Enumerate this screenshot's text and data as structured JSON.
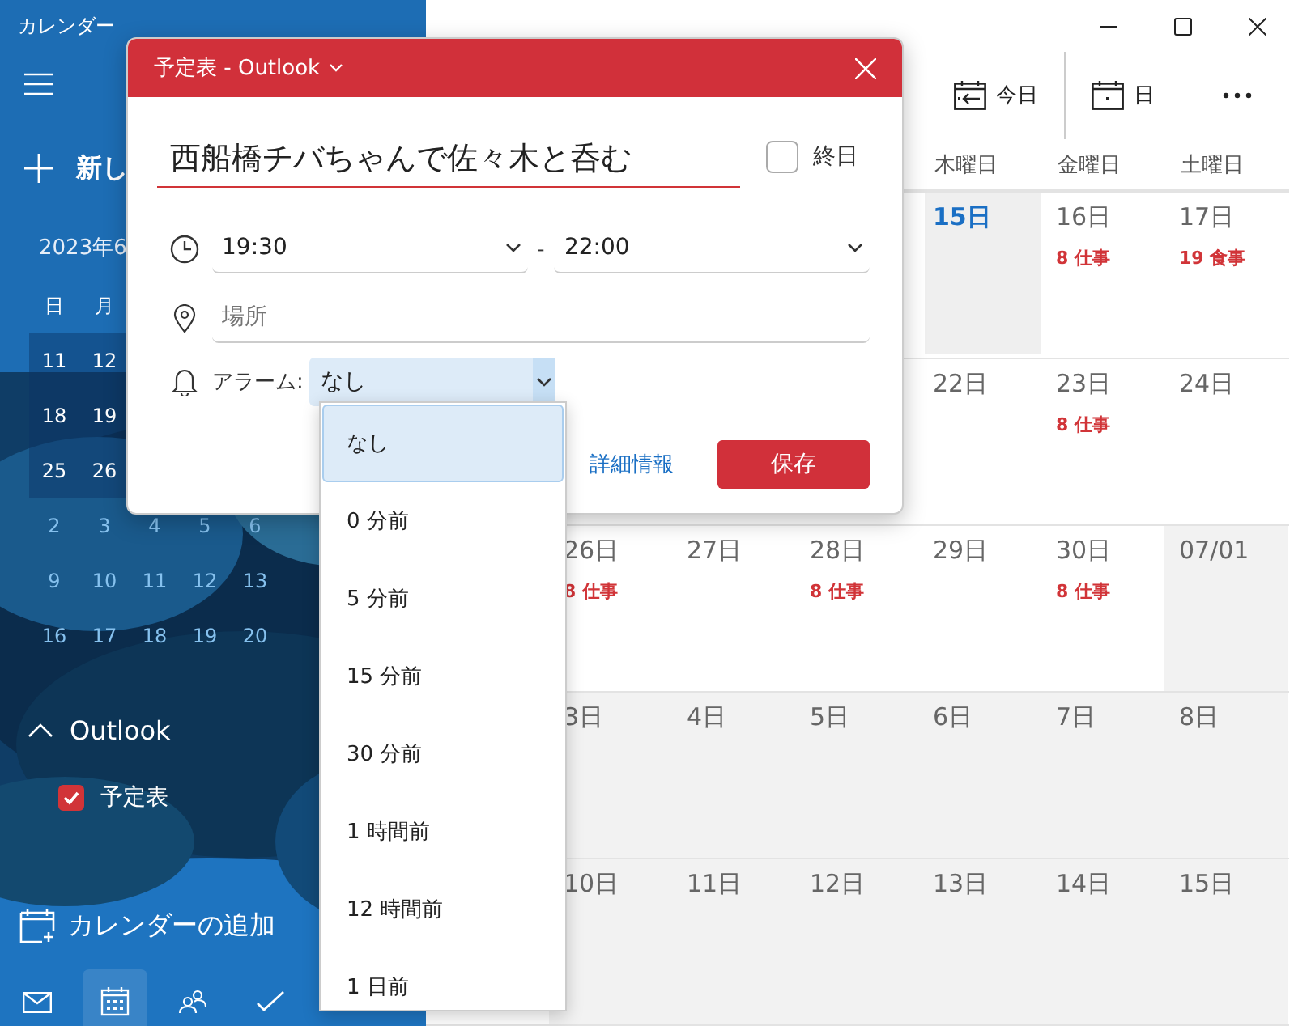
{
  "window": {
    "title": "カレンダー"
  },
  "sidebar": {
    "new_event": "新し",
    "mini_calendar": {
      "month": "2023年6",
      "weekdays": [
        "日",
        "月"
      ],
      "weeks": [
        {
          "days": [
            "11",
            "12"
          ],
          "selected": true,
          "current_month": true
        },
        {
          "days": [
            "18",
            "19"
          ],
          "selected": true,
          "current_month": true
        },
        {
          "days": [
            "25",
            "26"
          ],
          "selected": true,
          "current_month": true
        },
        {
          "days": [
            "2",
            "3",
            "4",
            "5",
            "6"
          ],
          "selected": false,
          "current_month": false
        },
        {
          "days": [
            "9",
            "10",
            "11",
            "12",
            "13"
          ],
          "selected": false,
          "current_month": false
        },
        {
          "days": [
            "16",
            "17",
            "18",
            "19",
            "20"
          ],
          "selected": false,
          "current_month": false
        }
      ]
    },
    "account": {
      "label": "Outlook",
      "expanded": true,
      "calendars": [
        {
          "label": "予定表",
          "checked": true,
          "color": "#d13438"
        }
      ]
    },
    "add_calendar": "カレンダーの追加",
    "nav": [
      {
        "kind": "mail",
        "selected": false
      },
      {
        "kind": "calendar",
        "selected": true
      },
      {
        "kind": "people",
        "selected": false
      },
      {
        "kind": "tasks",
        "selected": false
      }
    ]
  },
  "toolbar": [
    {
      "kind": "today",
      "label": "今日"
    },
    {
      "kind": "day",
      "label": "日"
    },
    {
      "kind": "more"
    }
  ],
  "calendar": {
    "weekdays": [
      "木曜日",
      "金曜日",
      "土曜日"
    ],
    "weeks": [
      {
        "cells": [
          {
            "day": "15日",
            "today": true,
            "other_month": false
          },
          {
            "day": "16日",
            "today": false,
            "other_month": false,
            "events": [
              "8 仕事"
            ]
          },
          {
            "day": "17日",
            "today": false,
            "other_month": false,
            "events": [
              "19 食事"
            ]
          }
        ]
      },
      {
        "cells": [
          {
            "day": "22日",
            "today": false,
            "other_month": false
          },
          {
            "day": "23日",
            "today": false,
            "other_month": false,
            "events": [
              "8 仕事"
            ]
          },
          {
            "day": "24日",
            "today": false,
            "other_month": false
          }
        ]
      },
      {
        "cells": [
          {
            "day": "26日",
            "today": false,
            "other_month": false,
            "events": [
              "8 仕事"
            ]
          },
          {
            "day": "27日",
            "today": false,
            "other_month": false
          },
          {
            "day": "28日",
            "today": false,
            "other_month": false,
            "events": [
              "8 仕事"
            ]
          },
          {
            "day": "29日",
            "today": false,
            "other_month": false
          },
          {
            "day": "30日",
            "today": false,
            "other_month": false,
            "events": [
              "8 仕事"
            ]
          },
          {
            "day": "07/01",
            "today": false,
            "other_month": true
          }
        ]
      },
      {
        "cells": [
          {
            "day": "3日",
            "today": false,
            "other_month": true
          },
          {
            "day": "4日",
            "today": false,
            "other_month": true
          },
          {
            "day": "5日",
            "today": false,
            "other_month": true
          },
          {
            "day": "6日",
            "today": false,
            "other_month": true
          },
          {
            "day": "7日",
            "today": false,
            "other_month": true
          },
          {
            "day": "8日",
            "today": false,
            "other_month": true
          }
        ]
      },
      {
        "cells": [
          {
            "day": "10日",
            "today": false,
            "other_month": true
          },
          {
            "day": "11日",
            "today": false,
            "other_month": true
          },
          {
            "day": "12日",
            "today": false,
            "other_month": true
          },
          {
            "day": "13日",
            "today": false,
            "other_month": true
          },
          {
            "day": "14日",
            "today": false,
            "other_month": true
          },
          {
            "day": "15日",
            "today": false,
            "other_month": true
          }
        ]
      }
    ]
  },
  "event_popup": {
    "calendar_label": "予定表 - Outlook",
    "title": "西船橋チバちゃんで佐々木と呑む",
    "all_day": {
      "label": "終日",
      "checked": false
    },
    "start": "19:30",
    "separator": "-",
    "end": "22:00",
    "location": {
      "placeholder": "場所"
    },
    "alarm": {
      "label": "アラーム:",
      "value": "なし",
      "expanded": true,
      "options": [
        {
          "label": "なし",
          "selected": true
        },
        {
          "label": "0 分前",
          "selected": false
        },
        {
          "label": "5 分前",
          "selected": false
        },
        {
          "label": "15 分前",
          "selected": false
        },
        {
          "label": "30 分前",
          "selected": false
        },
        {
          "label": "1 時間前",
          "selected": false
        },
        {
          "label": "12 時間前",
          "selected": false
        },
        {
          "label": "1 日前",
          "selected": false
        }
      ]
    },
    "more_details": "詳細情報",
    "save": "保存"
  }
}
